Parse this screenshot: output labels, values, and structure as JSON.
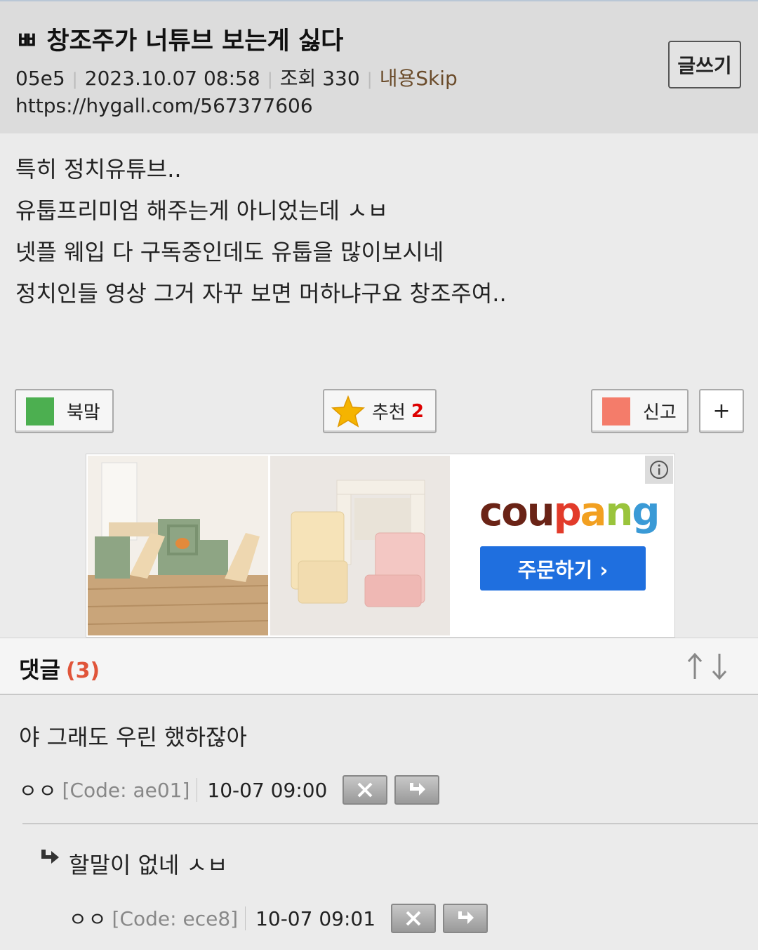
{
  "post": {
    "title": "ㅃ 창조주가 너튜브 보는게 싫다",
    "author": "05e5",
    "date": "2023.10.07 08:58",
    "views": "조회 330",
    "skip": "내용Skip",
    "url": "https://hygall.com/567377606",
    "write_label": "글쓰기",
    "body": [
      "특히 정치유튜브..",
      "유툽프리미엄 해주는게 아니었는데 ㅅㅂ",
      "넷플 웨입 다 구독중인데도 유툽을 많이보시네",
      "정치인들 영상 그거 자꾸 보면 머하냐구요 창조주여.."
    ]
  },
  "actions": {
    "bookmark": "북맠",
    "recommend": "추천",
    "recommend_count": "2",
    "report": "신고",
    "more": "+"
  },
  "ad": {
    "brand": "coupang",
    "order": "주문하기 ›"
  },
  "comments_header": {
    "title": "댓글",
    "count": "(3)"
  },
  "comments": [
    {
      "text": "야 그래도 우린 했하잖아",
      "nick": "ㅇㅇ",
      "code": "[Code: ae01]",
      "time": "10-07 09:00"
    },
    {
      "text": "할말이 없네 ㅅㅂ",
      "nick": "ㅇㅇ",
      "code": "[Code: ece8]",
      "time": "10-07 09:01"
    }
  ],
  "colors": {
    "header_bg": "#dcdcdc",
    "bookmark_green": "#4caf50",
    "report_red": "#f47c6a",
    "coupang_blue": "#1f6fdf",
    "count_red": "#dd0000",
    "comment_count": "#e0553a"
  }
}
